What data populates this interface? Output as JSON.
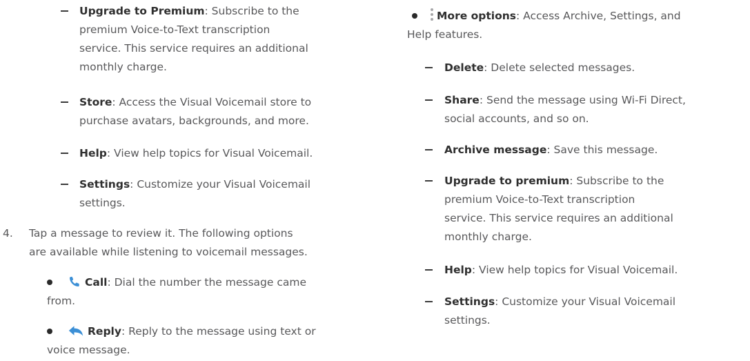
{
  "left_column": {
    "dash_items": [
      {
        "term": "Upgrade to Premium",
        "desc_line1": ": Subscribe to the",
        "desc_more": [
          "premium Voice-to-Text transcription",
          "service. This service requires an additional",
          "monthly charge."
        ]
      },
      {
        "term": "Store",
        "desc_line1": ": Access the Visual Voicemail store to",
        "desc_more": [
          "purchase avatars, backgrounds, and more."
        ]
      },
      {
        "term": "Help",
        "desc_line1": ": View help topics for Visual Voicemail.",
        "desc_more": []
      },
      {
        "term": "Settings",
        "desc_line1": ": Customize your Visual Voicemail",
        "desc_more": [
          "settings."
        ]
      }
    ],
    "step4": {
      "number": "4.",
      "line1": "Tap a message to review it. The following options",
      "line2": "are available while listening to voicemail messages."
    },
    "bullets": [
      {
        "icon": "phone-icon",
        "term": "Call",
        "desc_line1": ": Dial the number the message came",
        "desc_line2": "from."
      },
      {
        "icon": "reply-icon",
        "term": "Reply",
        "desc_line1": ": Reply to the message using text or",
        "desc_line2": "voice message."
      }
    ]
  },
  "right_column": {
    "bullet": {
      "icon": "more-options-icon",
      "term": "More options",
      "desc_line1": ": Access Archive, Settings, and",
      "desc_line2": "Help features."
    },
    "dash_items": [
      {
        "term": "Delete",
        "desc_line1": ": Delete selected messages.",
        "desc_more": []
      },
      {
        "term": "Share",
        "desc_line1": ": Send the message using Wi-Fi Direct,",
        "desc_more": [
          "social accounts, and so on."
        ]
      },
      {
        "term": "Archive message",
        "desc_line1": ": Save this message.",
        "desc_more": []
      },
      {
        "term": "Upgrade to premium",
        "desc_line1": ": Subscribe to the",
        "desc_more": [
          "premium Voice-to-Text transcription",
          "service. This service requires an additional",
          "monthly charge."
        ]
      },
      {
        "term": "Help",
        "desc_line1": ": View help topics for Visual Voicemail.",
        "desc_more": []
      },
      {
        "term": "Settings",
        "desc_line1": ": Customize your Visual Voicemail",
        "desc_more": [
          "settings."
        ]
      }
    ]
  },
  "colors": {
    "text": "#58585a",
    "term": "#2f2f2f",
    "icon_phone": "#3b8fd6",
    "icon_reply": "#3b8fd6",
    "icon_dots": "#a7a7a9"
  }
}
